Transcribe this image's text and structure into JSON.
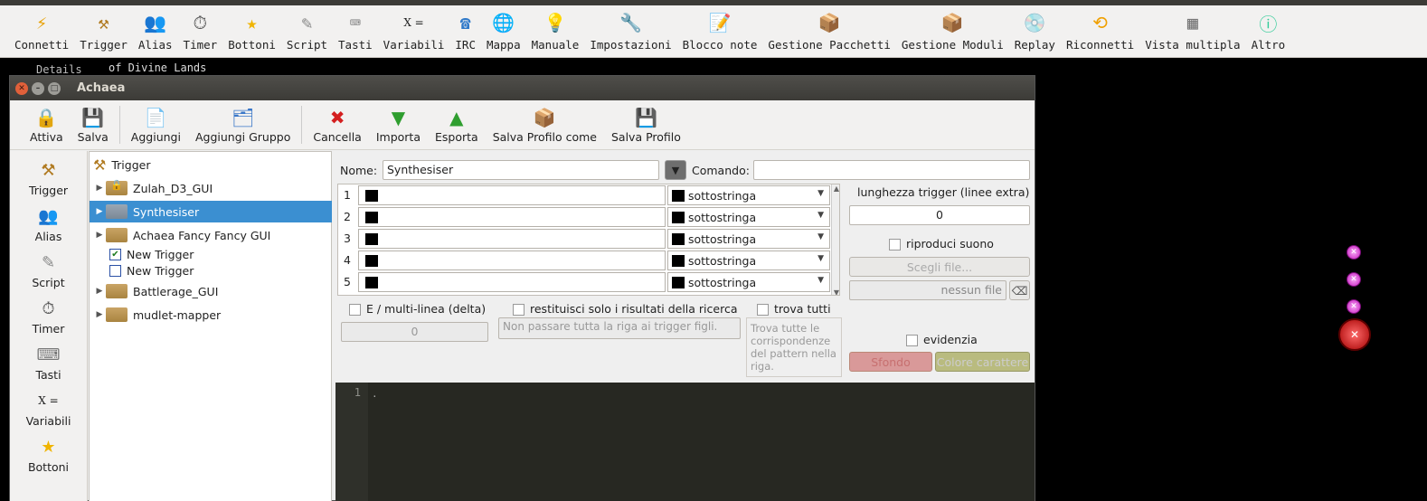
{
  "main_toolbar": {
    "items": [
      {
        "label": "Connetti",
        "icon": "connect-icon"
      },
      {
        "label": "Trigger",
        "icon": "trigger-icon"
      },
      {
        "label": "Alias",
        "icon": "alias-icon"
      },
      {
        "label": "Timer",
        "icon": "timer-icon"
      },
      {
        "label": "Bottoni",
        "icon": "star-icon"
      },
      {
        "label": "Script",
        "icon": "script-icon"
      },
      {
        "label": "Tasti",
        "icon": "keyboard-icon"
      },
      {
        "label": "Variabili",
        "icon": "variables-icon"
      },
      {
        "label": "IRC",
        "icon": "phone-icon"
      },
      {
        "label": "Mappa",
        "icon": "globe-icon"
      },
      {
        "label": "Manuale",
        "icon": "lightbulb-icon"
      },
      {
        "label": "Impostazioni",
        "icon": "wrench-icon"
      },
      {
        "label": "Blocco note",
        "icon": "notepad-icon"
      },
      {
        "label": "Gestione Pacchetti",
        "icon": "package-icon"
      },
      {
        "label": "Gestione Moduli",
        "icon": "module-icon"
      },
      {
        "label": "Replay",
        "icon": "disc-icon"
      },
      {
        "label": "Riconnetti",
        "icon": "reconnect-icon"
      },
      {
        "label": "Vista multipla",
        "icon": "multiview-icon"
      },
      {
        "label": "Altro",
        "icon": "more-icon"
      }
    ]
  },
  "background": {
    "details_text": "Details",
    "divine_text": "of Divine Lands"
  },
  "window": {
    "title": "Achaea"
  },
  "editor_toolbar": {
    "attiva": "Attiva",
    "salva": "Salva",
    "aggiungi": "Aggiungi",
    "aggiungi_gruppo": "Aggiungi Gruppo",
    "cancella": "Cancella",
    "importa": "Importa",
    "esporta": "Esporta",
    "salva_profilo_come": "Salva Profilo come",
    "salva_profilo": "Salva Profilo"
  },
  "left_panel": {
    "items": [
      {
        "label": "Trigger"
      },
      {
        "label": "Alias"
      },
      {
        "label": "Script"
      },
      {
        "label": "Timer"
      },
      {
        "label": "Tasti"
      },
      {
        "label": "Variabili"
      },
      {
        "label": "Bottoni"
      }
    ]
  },
  "tree": {
    "root": "Trigger",
    "items": [
      {
        "label": "Zulah_D3_GUI"
      },
      {
        "label": "Synthesiser"
      },
      {
        "label": "Achaea Fancy Fancy GUI"
      },
      {
        "label": "New Trigger"
      },
      {
        "label": "New Trigger"
      },
      {
        "label": "Battlerage_GUI"
      },
      {
        "label": "mudlet-mapper"
      }
    ]
  },
  "form": {
    "name_label": "Nome:",
    "name_value": "Synthesiser",
    "command_label": "Comando:",
    "command_value": "",
    "patterns": [
      {
        "num": "1",
        "type": "sottostringa"
      },
      {
        "num": "2",
        "type": "sottostringa"
      },
      {
        "num": "3",
        "type": "sottostringa"
      },
      {
        "num": "4",
        "type": "sottostringa"
      },
      {
        "num": "5",
        "type": "sottostringa"
      }
    ],
    "trigger_length_label": "lunghezza trigger (linee extra)",
    "trigger_length_value": "0",
    "play_sound_label": "riproduci suono",
    "choose_file": "Scegli file...",
    "no_file": "nessun file",
    "multiline_label": "E / multi-linea (delta)",
    "multiline_value": "0",
    "return_results_label": "restituisci solo i risultati della ricerca",
    "no_pass_placeholder": "Non passare tutta la riga ai trigger figli.",
    "find_all_label": "trova tutti",
    "find_all_desc": "Trova tutte le corrispondenze del pattern nella riga.",
    "highlight_label": "evidenzia",
    "bg_button": "Sfondo",
    "fg_button": "Colore carattere"
  },
  "code": {
    "line_number": "1",
    "content": "."
  },
  "colors": {
    "accent": "#3b8fd1",
    "titlebar": "#3c3b37",
    "code_bg": "#272822"
  }
}
